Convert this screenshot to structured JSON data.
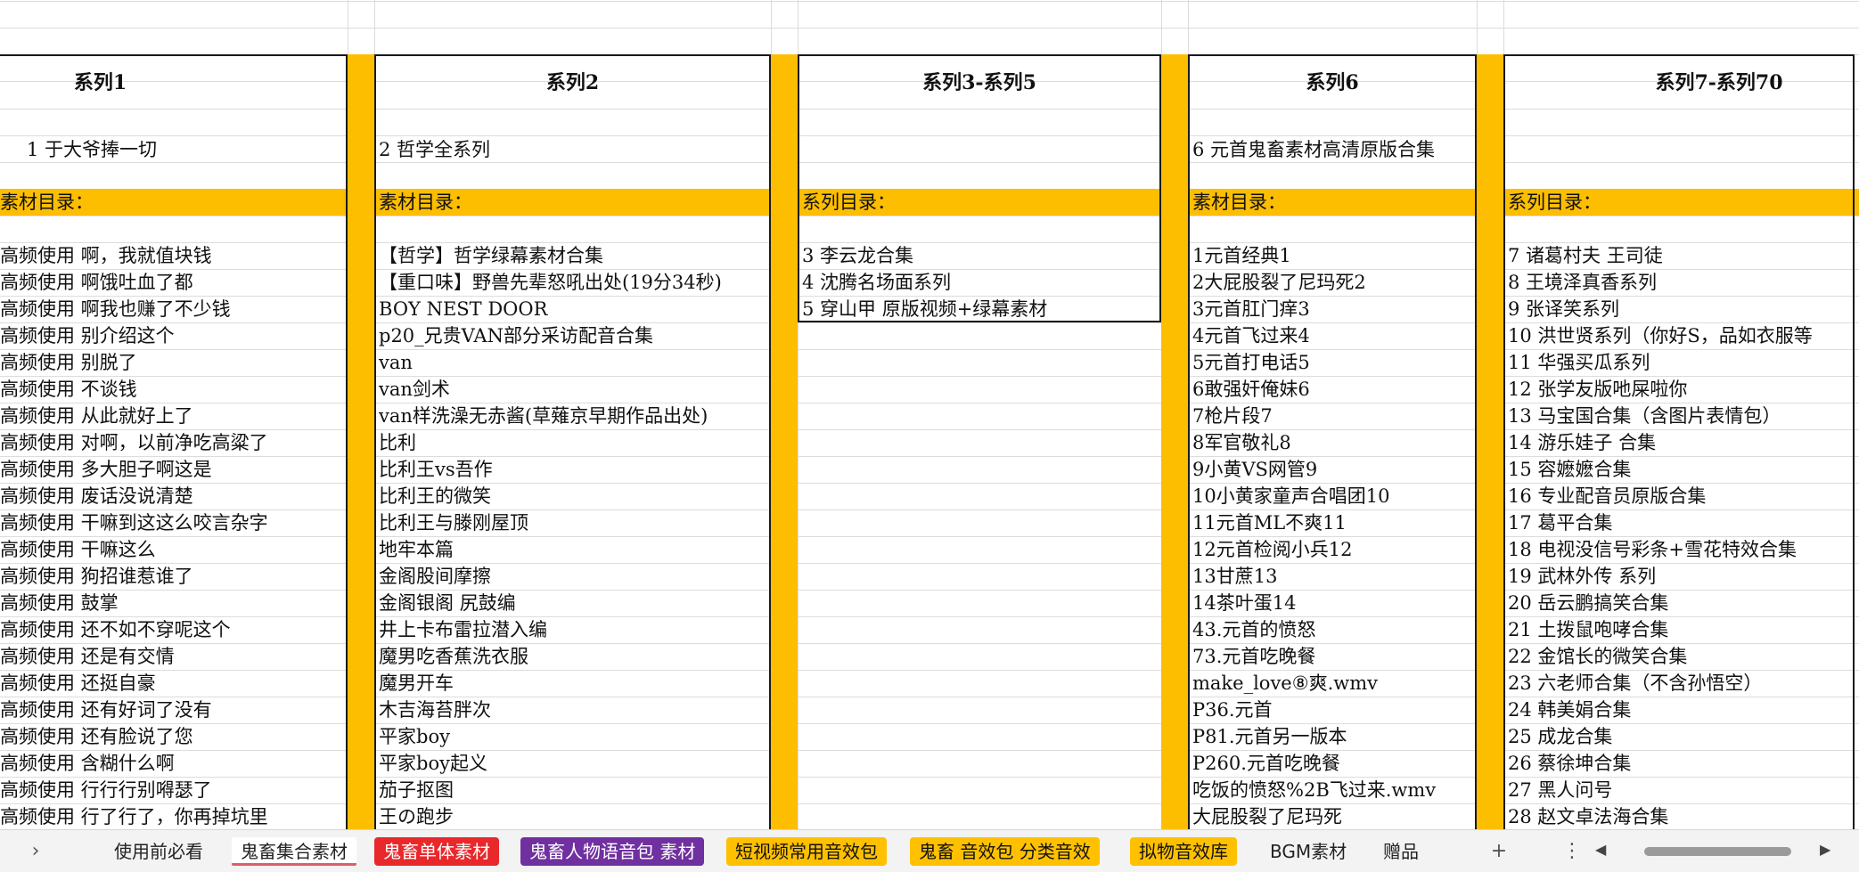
{
  "headers": [
    "系列1",
    "系列2",
    "系列3-系列5",
    "系列6",
    "系列7-系列70"
  ],
  "subtitles": [
    "1 于大爷捧一切",
    "2 哲学全系列",
    "",
    "6 元首鬼畜素材高清原版合集",
    ""
  ],
  "catalog_labels": [
    "素材目录：",
    "素材目录：",
    "系列目录：",
    "素材目录：",
    "系列目录："
  ],
  "columns": [
    [
      "高频使用 啊，我就值块钱",
      "高频使用 啊饿吐血了都",
      "高频使用 啊我也赚了不少钱",
      "高频使用 别介绍这个",
      "高频使用 别脱了",
      "高频使用 不谈钱",
      "高频使用 从此就好上了",
      "高频使用 对啊，以前净吃高粱了",
      "高频使用 多大胆子啊这是",
      "高频使用 废话没说清楚",
      "高频使用 干嘛到这这么咬言杂字",
      "高频使用 干嘛这么",
      "高频使用 狗招谁惹谁了",
      "高频使用 鼓掌",
      "高频使用 还不如不穿呢这个",
      "高频使用 还是有交情",
      "高频使用 还挺自豪",
      "高频使用 还有好词了没有",
      "高频使用 还有脸说了您",
      "高频使用 含糊什么啊",
      "高频使用 行行行别嘚瑟了",
      "高频使用 行了行了，你再掉坑里"
    ],
    [
      "【哲学】哲学绿幕素材合集",
      "【重口味】野兽先辈怒吼出处(19分34秒)",
      "BOY NEST DOOR",
      "p20_兄贵VAN部分采访配音合集",
      "van",
      "van剑术",
      "van样洗澡无赤酱(草薙京早期作品出处)",
      "比利",
      "比利王vs吾作",
      "比利王的微笑",
      "比利王与滕刚屋顶",
      "地牢本篇",
      "金阁股间摩擦",
      "金阁银阁 尻鼓编",
      "井上卡布雷拉潜入编",
      "魔男吃香蕉洗衣服",
      "魔男开车",
      "木吉海苔胖次",
      "平家boy",
      "平家boy起义",
      "茄子抠图",
      "王の跑步"
    ],
    [
      "3 李云龙合集",
      "4 沈腾名场面系列",
      "5 穿山甲 原版视频+绿幕素材"
    ],
    [
      "1元首经典1",
      "2大屁股裂了尼玛死2",
      "3元首肛门痒3",
      "4元首飞过来4",
      "5元首打电话5",
      "6敢强奸俺妹6",
      "7枪片段7",
      "8军官敬礼8",
      "9小黄VS网管9",
      "10小黄家童声合唱团10",
      "11元首ML不爽11",
      "12元首检阅小兵12",
      "13甘蔗13",
      "14茶叶蛋14",
      "43.元首的愤怒",
      "73.元首吃晚餐",
      "make_love⑧爽.wmv",
      "P36.元首",
      "P81.元首另一版本",
      "P260.元首吃晚餐",
      "吃饭的愤怒%2B飞过来.wmv",
      "大屁股裂了尼玛死"
    ],
    [
      "7 诸葛村夫 王司徒",
      "8 王境泽真香系列",
      "9 张译笑系列",
      "10 洪世贤系列（你好S，品如衣服等",
      "11 华强买瓜系列",
      "12 张学友版吔屎啦你",
      "13 马宝国合集（含图片表情包）",
      "14 游乐娃子 合集",
      "15 容嬷嬷合集",
      "16 专业配音员原版合集",
      "17 葛平合集",
      "18 电视没信号彩条+雪花特效合集",
      "19 武林外传 系列",
      "20 岳云鹏搞笑合集",
      "21 土拨鼠咆哮合集",
      "22 金馆长的微笑合集",
      "23 六老师合集（不含孙悟空）",
      "24 韩美娟合集",
      "25 成龙合集",
      "26 蔡徐坤合集",
      "27 黑人问号",
      "28 赵文卓法海合集"
    ]
  ],
  "tabs": [
    {
      "label": "使用前必看",
      "style": "plain"
    },
    {
      "label": "鬼畜集合素材",
      "style": "active"
    },
    {
      "label": "鬼畜单体素材",
      "style": "red"
    },
    {
      "label": "鬼畜人物语音包 素材",
      "style": "purple"
    },
    {
      "label": "短视频常用音效包",
      "style": "yellow"
    },
    {
      "label": "鬼畜 音效包 分类音效",
      "style": "yellow"
    },
    {
      "label": "拟物音效库",
      "style": "yellow"
    },
    {
      "label": "BGM素材",
      "style": "plain"
    },
    {
      "label": "赠品",
      "style": "plain"
    }
  ],
  "icons": {
    "nav_next": "chevron-right-icon",
    "add_sheet": "plus-icon",
    "more": "more-vertical-icon",
    "scroll_left": "triangle-left-icon",
    "scroll_right": "triangle-right-icon"
  },
  "colors": {
    "accent_yellow": "#FDBE00",
    "tab_red": "#E8282B",
    "tab_purple": "#7030A0",
    "tab_yellow": "#FFC000"
  }
}
